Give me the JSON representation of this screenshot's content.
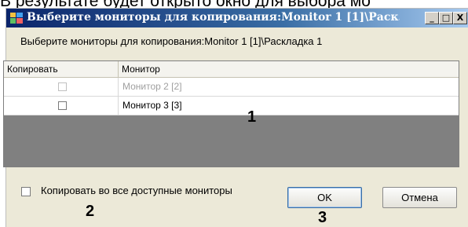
{
  "caption_text": "В результате будет открыто окно для выбора мо",
  "window": {
    "title": "Выберите мониторы для копирования:Monitor 1 [1]\\Раск...",
    "controls": {
      "minimize": "_",
      "maximize": "□",
      "close": "X"
    }
  },
  "prompt": "Выберите мониторы для копирования:Monitor 1 [1]\\Раскладка 1",
  "grid": {
    "columns": [
      "Копировать",
      "Монитор"
    ],
    "rows": [
      {
        "monitor": "Монитор 2 [2]",
        "checked": false,
        "disabled": true
      },
      {
        "monitor": "Монитор 3 [3]",
        "checked": false,
        "disabled": false
      }
    ]
  },
  "copy_all_label": "Копировать во все доступные мониторы",
  "buttons": {
    "ok": "OK",
    "cancel": "Отмена"
  },
  "annotations": {
    "a1": "1",
    "a2": "2",
    "a3": "3"
  },
  "colors": {
    "titlebar": "#0a246a",
    "window_bg": "#ece9d8",
    "grid_bg": "#808080"
  },
  "icons": {
    "title": "monitor-grid-icon"
  }
}
